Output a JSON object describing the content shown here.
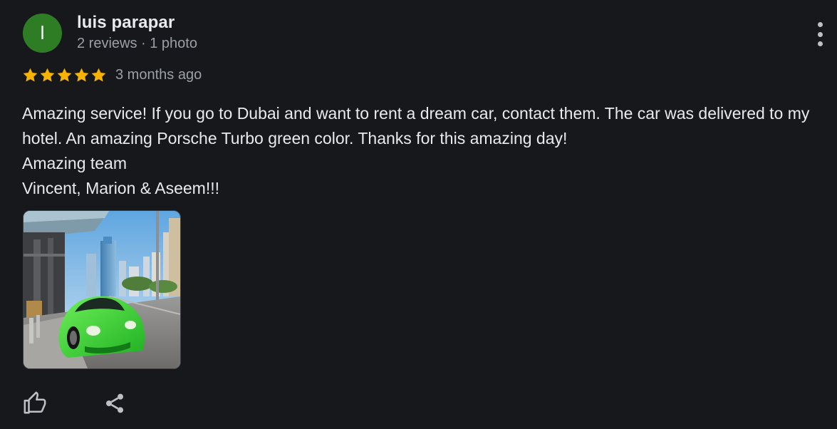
{
  "author": {
    "initial": "l",
    "name": "luis parapar",
    "meta": "2 reviews · 1 photo",
    "avatar_color": "#2e7d24"
  },
  "rating": {
    "stars": 5,
    "max": 5,
    "star_color": "#f6b301",
    "time": "3 months ago"
  },
  "review": {
    "lines": [
      "Amazing service! If you go to Dubai and want to rent a dream car, contact them. The car was delivered to my hotel. An amazing Porsche Turbo green color. Thanks for this amazing day!",
      "Amazing team",
      "Vincent, Marion & Aseem!!!"
    ]
  },
  "photo": {
    "subject": "green-sports-car-photo"
  },
  "actions": {
    "like_icon": "thumbs-up-icon",
    "share_icon": "share-icon",
    "more_icon": "more-vert-icon"
  }
}
